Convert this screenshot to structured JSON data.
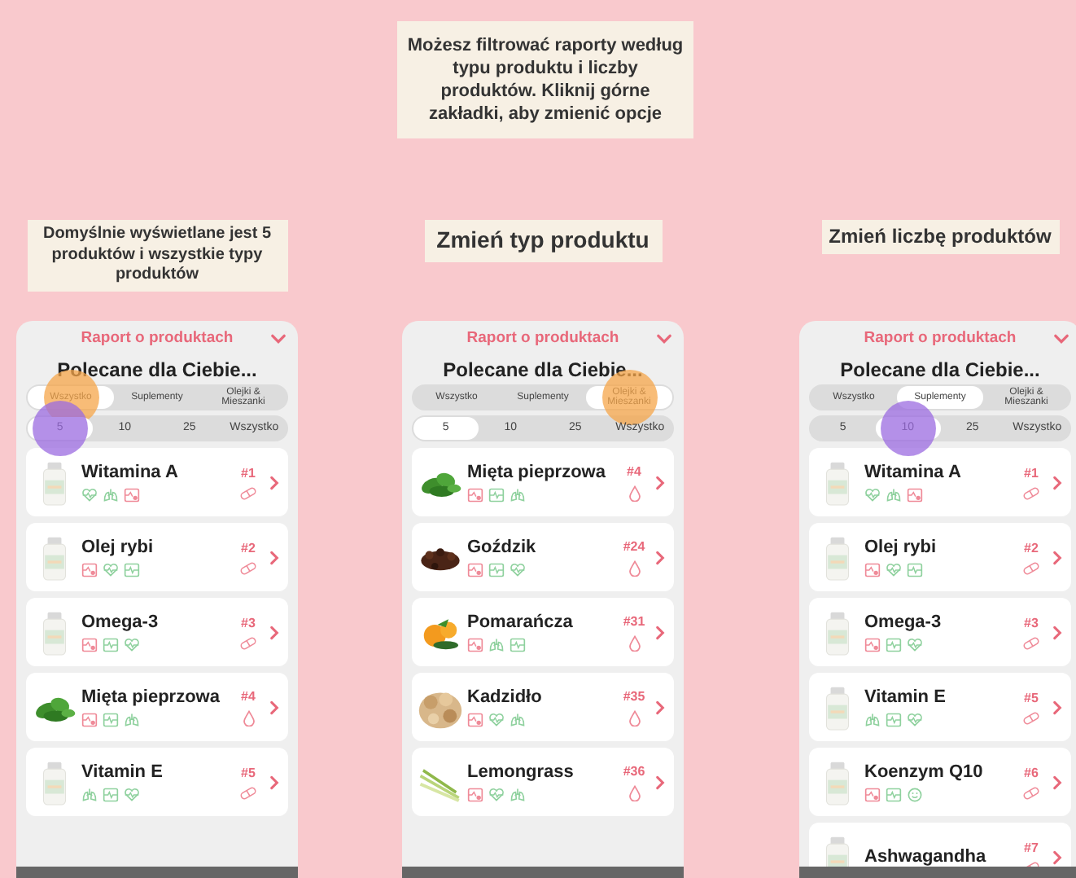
{
  "intro": "Możesz filtrować raporty według typu produktu i liczby produktów. Kliknij górne zakładki, aby zmienić opcje",
  "panels": [
    {
      "caption": "Domyślnie wyświetlane jest 5 produktów i wszystkie typy produktów",
      "header": "Raport o produktach",
      "title": "Polecane dla Ciebie...",
      "type_tabs": [
        {
          "label": "Wszystko",
          "selected": true,
          "touched": true
        },
        {
          "label": "Suplementy",
          "selected": false,
          "touched": false
        },
        {
          "label": "Olejki & Mieszanki",
          "selected": false,
          "touched": false
        }
      ],
      "count_tabs": [
        {
          "label": "5",
          "selected": true,
          "touched": true
        },
        {
          "label": "10",
          "selected": false,
          "touched": false
        },
        {
          "label": "25",
          "selected": false,
          "touched": false
        },
        {
          "label": "Wszystko",
          "selected": false,
          "touched": false
        }
      ],
      "products": [
        {
          "name": "Witamina A",
          "rank": "#1",
          "kind": "supplement",
          "icons": [
            {
              "kind": "heart",
              "color": "#8fd19e"
            },
            {
              "kind": "lungs",
              "color": "#8fd19e"
            },
            {
              "kind": "chart",
              "color": "#ef8a98"
            }
          ]
        },
        {
          "name": "Olej rybi",
          "rank": "#2",
          "kind": "supplement",
          "icons": [
            {
              "kind": "chart",
              "color": "#ef8a98"
            },
            {
              "kind": "heart",
              "color": "#8fd19e"
            },
            {
              "kind": "monitor",
              "color": "#8fd19e"
            }
          ]
        },
        {
          "name": "Omega-3",
          "rank": "#3",
          "kind": "supplement",
          "icons": [
            {
              "kind": "chart",
              "color": "#ef8a98"
            },
            {
              "kind": "monitor",
              "color": "#8fd19e"
            },
            {
              "kind": "heart",
              "color": "#8fd19e"
            }
          ]
        },
        {
          "name": "Mięta pieprzowa",
          "rank": "#4",
          "kind": "oil",
          "icons": [
            {
              "kind": "chart",
              "color": "#ef8a98"
            },
            {
              "kind": "monitor",
              "color": "#8fd19e"
            },
            {
              "kind": "lungs",
              "color": "#8fd19e"
            }
          ]
        },
        {
          "name": "Vitamin E",
          "rank": "#5",
          "kind": "supplement",
          "icons": [
            {
              "kind": "lungs",
              "color": "#8fd19e"
            },
            {
              "kind": "monitor",
              "color": "#8fd19e"
            },
            {
              "kind": "heart",
              "color": "#8fd19e"
            }
          ]
        }
      ]
    },
    {
      "caption": "Zmień typ produktu",
      "header": "Raport o produktach",
      "title": "Polecane dla Ciebie...",
      "type_tabs": [
        {
          "label": "Wszystko",
          "selected": false,
          "touched": false
        },
        {
          "label": "Suplementy",
          "selected": false,
          "touched": false
        },
        {
          "label": "Olejki & Mieszanki",
          "selected": true,
          "touched": true
        }
      ],
      "count_tabs": [
        {
          "label": "5",
          "selected": true,
          "touched": false
        },
        {
          "label": "10",
          "selected": false,
          "touched": false
        },
        {
          "label": "25",
          "selected": false,
          "touched": false
        },
        {
          "label": "Wszystko",
          "selected": false,
          "touched": false
        }
      ],
      "products": [
        {
          "name": "Mięta pieprzowa",
          "rank": "#4",
          "kind": "oil",
          "icons": [
            {
              "kind": "chart",
              "color": "#ef8a98"
            },
            {
              "kind": "monitor",
              "color": "#8fd19e"
            },
            {
              "kind": "lungs",
              "color": "#8fd19e"
            }
          ]
        },
        {
          "name": "Goździk",
          "rank": "#24",
          "kind": "oil",
          "icons": [
            {
              "kind": "chart",
              "color": "#ef8a98"
            },
            {
              "kind": "monitor",
              "color": "#8fd19e"
            },
            {
              "kind": "heart",
              "color": "#8fd19e"
            }
          ]
        },
        {
          "name": "Pomarańcza",
          "rank": "#31",
          "kind": "oil",
          "icons": [
            {
              "kind": "chart",
              "color": "#ef8a98"
            },
            {
              "kind": "lungs",
              "color": "#8fd19e"
            },
            {
              "kind": "monitor",
              "color": "#8fd19e"
            }
          ]
        },
        {
          "name": "Kadzidło",
          "rank": "#35",
          "kind": "oil",
          "icons": [
            {
              "kind": "chart",
              "color": "#ef8a98"
            },
            {
              "kind": "heart",
              "color": "#8fd19e"
            },
            {
              "kind": "lungs",
              "color": "#8fd19e"
            }
          ]
        },
        {
          "name": "Lemongrass",
          "rank": "#36",
          "kind": "oil",
          "icons": [
            {
              "kind": "chart",
              "color": "#ef8a98"
            },
            {
              "kind": "heart",
              "color": "#8fd19e"
            },
            {
              "kind": "lungs",
              "color": "#8fd19e"
            }
          ]
        }
      ]
    },
    {
      "caption": "Zmień liczbę produktów",
      "header": "Raport o produktach",
      "title": "Polecane dla Ciebie...",
      "type_tabs": [
        {
          "label": "Wszystko",
          "selected": false,
          "touched": false
        },
        {
          "label": "Suplementy",
          "selected": true,
          "touched": false
        },
        {
          "label": "Olejki & Mieszanki",
          "selected": false,
          "touched": false
        }
      ],
      "count_tabs": [
        {
          "label": "5",
          "selected": false,
          "touched": false
        },
        {
          "label": "10",
          "selected": true,
          "touched": true
        },
        {
          "label": "25",
          "selected": false,
          "touched": false
        },
        {
          "label": "Wszystko",
          "selected": false,
          "touched": false
        }
      ],
      "products": [
        {
          "name": "Witamina A",
          "rank": "#1",
          "kind": "supplement",
          "icons": [
            {
              "kind": "heart",
              "color": "#8fd19e"
            },
            {
              "kind": "lungs",
              "color": "#8fd19e"
            },
            {
              "kind": "chart",
              "color": "#ef8a98"
            }
          ]
        },
        {
          "name": "Olej rybi",
          "rank": "#2",
          "kind": "supplement",
          "icons": [
            {
              "kind": "chart",
              "color": "#ef8a98"
            },
            {
              "kind": "heart",
              "color": "#8fd19e"
            },
            {
              "kind": "monitor",
              "color": "#8fd19e"
            }
          ]
        },
        {
          "name": "Omega-3",
          "rank": "#3",
          "kind": "supplement",
          "icons": [
            {
              "kind": "chart",
              "color": "#ef8a98"
            },
            {
              "kind": "monitor",
              "color": "#8fd19e"
            },
            {
              "kind": "heart",
              "color": "#8fd19e"
            }
          ]
        },
        {
          "name": "Vitamin E",
          "rank": "#5",
          "kind": "supplement",
          "icons": [
            {
              "kind": "lungs",
              "color": "#8fd19e"
            },
            {
              "kind": "monitor",
              "color": "#8fd19e"
            },
            {
              "kind": "heart",
              "color": "#8fd19e"
            }
          ]
        },
        {
          "name": "Koenzym Q10",
          "rank": "#6",
          "kind": "supplement",
          "icons": [
            {
              "kind": "chart",
              "color": "#ef8a98"
            },
            {
              "kind": "monitor",
              "color": "#8fd19e"
            },
            {
              "kind": "smile",
              "color": "#8fd19e"
            }
          ]
        },
        {
          "name": "Ashwagandha",
          "rank": "#7",
          "kind": "supplement"
        }
      ]
    }
  ]
}
